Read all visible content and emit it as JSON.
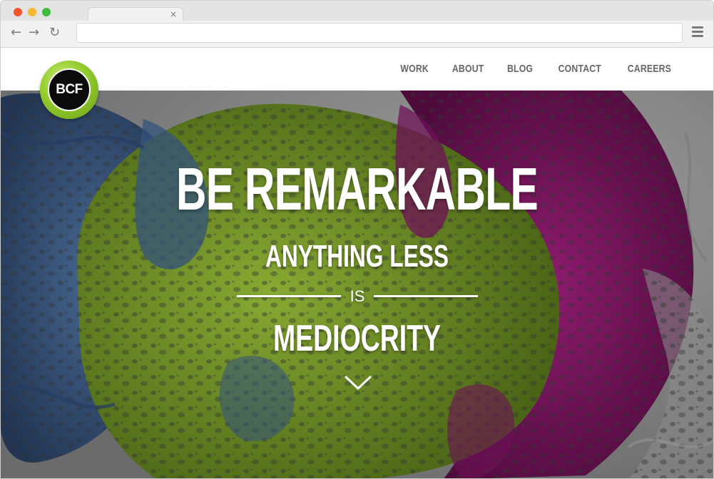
{
  "browser": {
    "tab_close_glyph": "×",
    "url": ""
  },
  "logo": {
    "text": "BCF",
    "ring_color": "#93cc2c"
  },
  "nav": {
    "items": [
      {
        "label": "WORK"
      },
      {
        "label": "ABOUT"
      },
      {
        "label": "BLOG"
      },
      {
        "label": "CONTACT"
      },
      {
        "label": "CAREERS"
      }
    ]
  },
  "hero": {
    "headline": "BE REMARKABLE",
    "line1": "ANYTHING LESS",
    "connector": "IS",
    "line2": "MEDIOCRITY",
    "scroll_icon": "chevron-down-icon",
    "colors": {
      "green": "#7fa323",
      "purple": "#7d1463",
      "blue": "#3b5e8e",
      "background": "#8e8e8e"
    }
  }
}
